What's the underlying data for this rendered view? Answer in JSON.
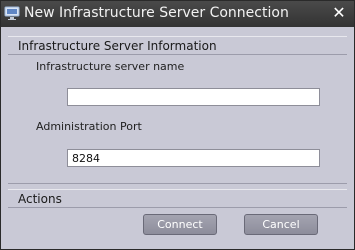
{
  "window": {
    "title": "New Infrastructure Server Connection",
    "title_icon": "monitor-icon",
    "close_icon": "close-icon",
    "close_glyph": "✕"
  },
  "info_section": {
    "header": "Infrastructure Server Information",
    "server_name_label": "Infrastructure server name",
    "server_name_value": "",
    "admin_port_label": "Administration Port",
    "admin_port_value": "8284"
  },
  "actions_section": {
    "header": "Actions",
    "connect_label": "Connect",
    "cancel_label": "Cancel"
  }
}
